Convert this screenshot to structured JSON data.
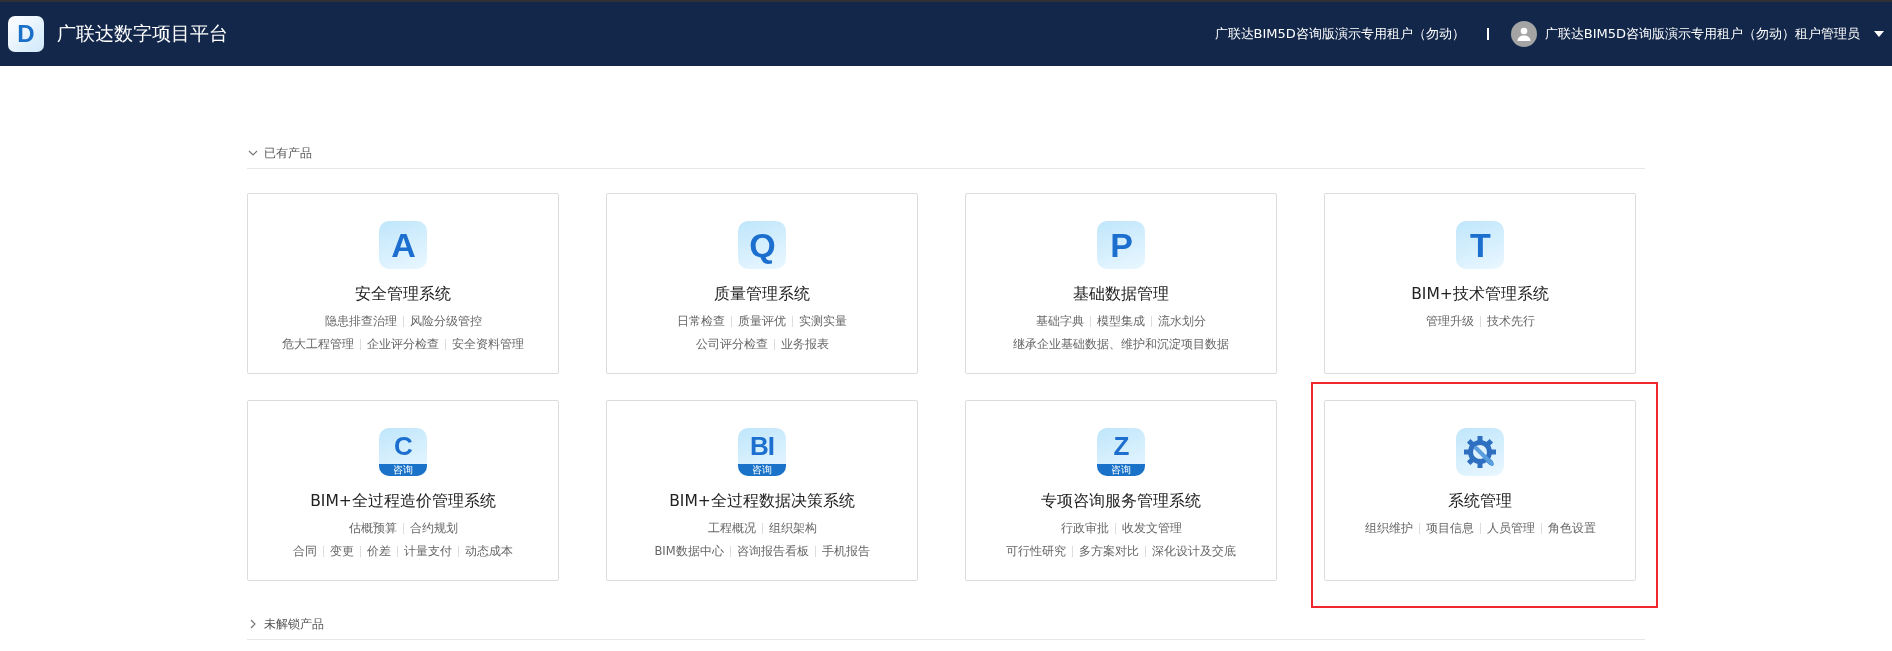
{
  "header": {
    "logo_letter": "D",
    "title": "广联达数字项目平台",
    "tenant": "广联达BIM5D咨询版演示专用租户（勿动）",
    "user": "广联达BIM5D咨询版演示专用租户（勿动）租户管理员"
  },
  "sections": [
    {
      "title": "已有产品",
      "expanded": true,
      "cards": [
        {
          "icon": {
            "kind": "letter",
            "letter": "A"
          },
          "name": "安全管理系统",
          "highlighted": false,
          "lines": [
            [
              "隐患排查治理",
              "风险分级管控"
            ],
            [
              "危大工程管理",
              "企业评分检查",
              "安全资料管理"
            ]
          ]
        },
        {
          "icon": {
            "kind": "letter",
            "letter": "Q"
          },
          "name": "质量管理系统",
          "highlighted": false,
          "lines": [
            [
              "日常检查",
              "质量评优",
              "实测实量"
            ],
            [
              "公司评分检查",
              "业务报表"
            ]
          ]
        },
        {
          "icon": {
            "kind": "letter",
            "letter": "P"
          },
          "name": "基础数据管理",
          "highlighted": false,
          "lines": [
            [
              "基础字典",
              "模型集成",
              "流水划分"
            ],
            [
              "继承企业基础数据、维护和沉淀项目数据"
            ]
          ]
        },
        {
          "icon": {
            "kind": "letter",
            "letter": "T"
          },
          "name": "BIM+技术管理系统",
          "highlighted": false,
          "lines": [
            [
              "管理升级",
              "技术先行"
            ]
          ]
        },
        {
          "icon": {
            "kind": "letter",
            "letter": "C",
            "band": "咨询"
          },
          "name": "BIM+全过程造价管理系统",
          "highlighted": false,
          "lines": [
            [
              "估概预算",
              "合约规划"
            ],
            [
              "合同",
              "变更",
              "价差",
              "计量支付",
              "动态成本"
            ]
          ]
        },
        {
          "icon": {
            "kind": "letter",
            "letter": "BI",
            "band": "咨询"
          },
          "name": "BIM+全过程数据决策系统",
          "highlighted": false,
          "lines": [
            [
              "工程概况",
              "组织架构"
            ],
            [
              "BIM数据中心",
              "咨询报告看板",
              "手机报告"
            ]
          ]
        },
        {
          "icon": {
            "kind": "letter",
            "letter": "Z",
            "band": "咨询"
          },
          "name": "专项咨询服务管理系统",
          "highlighted": false,
          "lines": [
            [
              "行政审批",
              "收发文管理"
            ],
            [
              "可行性研究",
              "多方案对比",
              "深化设计及交底"
            ]
          ]
        },
        {
          "icon": {
            "kind": "gear"
          },
          "name": "系统管理",
          "highlighted": true,
          "lines": [
            [
              "组织维护",
              "项目信息",
              "人员管理",
              "角色设置"
            ]
          ]
        }
      ]
    },
    {
      "title": "未解锁产品",
      "expanded": false
    }
  ]
}
